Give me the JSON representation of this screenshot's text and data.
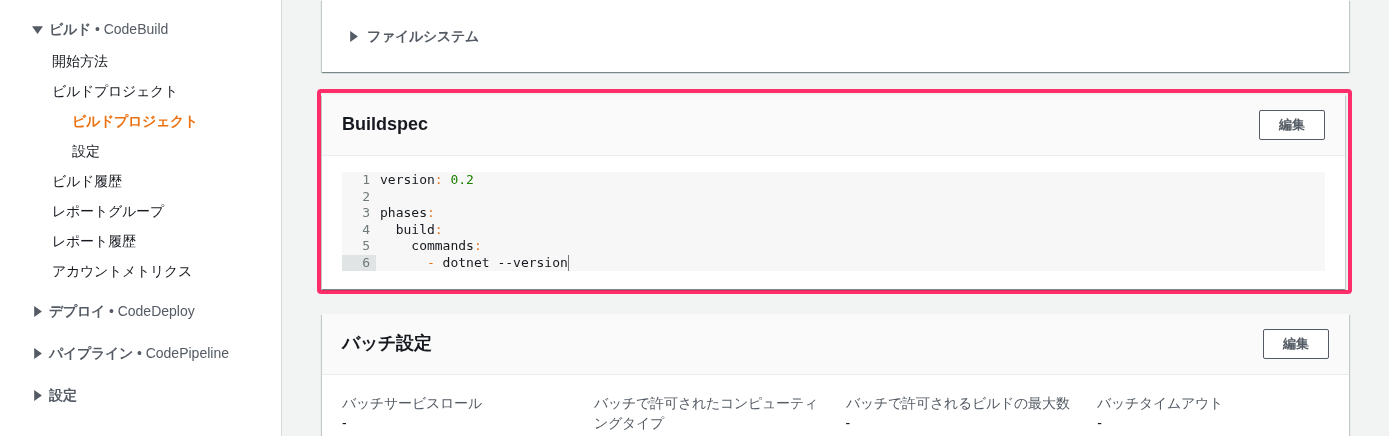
{
  "sidebar": {
    "sections": [
      {
        "title": "ビルド",
        "service": "• CodeBuild",
        "expanded": true,
        "items": [
          {
            "label": "開始方法",
            "selected": false
          },
          {
            "label": "ビルドプロジェクト",
            "selected": false,
            "children": [
              {
                "label": "ビルドプロジェクト",
                "selected": true
              },
              {
                "label": "設定",
                "selected": false
              }
            ]
          },
          {
            "label": "ビルド履歴",
            "selected": false
          },
          {
            "label": "レポートグループ",
            "selected": false
          },
          {
            "label": "レポート履歴",
            "selected": false
          },
          {
            "label": "アカウントメトリクス",
            "selected": false
          }
        ]
      },
      {
        "title": "デプロイ",
        "service": "• CodeDeploy",
        "expanded": false
      },
      {
        "title": "パイプライン",
        "service": "• CodePipeline",
        "expanded": false
      },
      {
        "title": "設定",
        "expanded": false
      }
    ]
  },
  "file_system": {
    "title": "ファイルシステム",
    "expanded": false
  },
  "buildspec": {
    "title": "Buildspec",
    "edit_button": "編集",
    "highlighted": true,
    "lines": [
      {
        "number": "1",
        "active": false,
        "tokens": [
          {
            "kind": "key",
            "text": "version"
          },
          {
            "kind": "punct",
            "text": ":"
          },
          {
            "kind": "number",
            "text": " 0.2"
          }
        ]
      },
      {
        "number": "2",
        "active": false
      },
      {
        "number": "3",
        "active": false,
        "tokens": [
          {
            "kind": "key",
            "text": "phases"
          },
          {
            "kind": "punct",
            "text": ":"
          }
        ]
      },
      {
        "number": "4",
        "active": false,
        "tokens": [
          {
            "kind": "key",
            "text": "  build"
          },
          {
            "kind": "punct",
            "text": ":"
          }
        ]
      },
      {
        "number": "5",
        "active": false,
        "tokens": [
          {
            "kind": "key",
            "text": "    commands"
          },
          {
            "kind": "punct",
            "text": ":"
          }
        ]
      },
      {
        "number": "6",
        "active": true,
        "tokens": [
          {
            "kind": "punct",
            "text": "      -"
          },
          {
            "kind": "plain",
            "text": " dotnet --version"
          }
        ]
      }
    ]
  },
  "batch": {
    "title": "バッチ設定",
    "edit_button": "編集",
    "fields": [
      {
        "label": "バッチサービスロール",
        "value": "-"
      },
      {
        "label": "バッチで許可されたコンピューティングタイプ"
      },
      {
        "label": "バッチで許可されるビルドの最大数",
        "value": "-"
      },
      {
        "label": "バッチタイムアウト",
        "value": "-"
      }
    ]
  }
}
